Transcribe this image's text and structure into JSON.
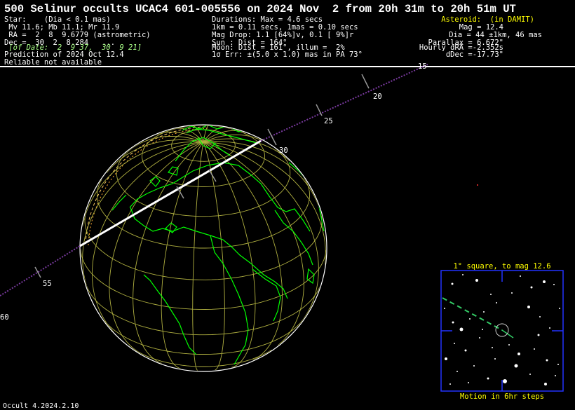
{
  "header": {
    "title": "500 Selinur occults UCAC4 601-005556 on 2024 Nov  2 from 20h 31m to 20h 51m UT"
  },
  "star": {
    "line1": "Star:    (Dia < 0.1 mas)",
    "line2": " Mv 11.6; Mb 11.1; Mr 11.9",
    "line3": " RA =  2  8  9.6779 (astrometric)",
    "line4": "Dec =  30  2  8.284   ...",
    "line5": " [of Date:  2  9 37,  30  9 21]",
    "line6": "Prediction of 2024 Oct 12.4",
    "line7": "Reliable not available"
  },
  "event": {
    "line1": "Durations: Max = 4.6 secs",
    "line2": "1km = 0.11 secs, 1mas = 0.10 secs",
    "line3": "Mag Drop: 1.1 [64%]v, 0.1 [ 9%]r",
    "line4": "Sun : Dist = 164°",
    "line5": "Moon: Dist = 161°, illum =  2%",
    "line6": "1σ Err: ±(5.0 x 1.0) mas in PA 73°"
  },
  "asteroid": {
    "heading": "Asteroid:  (in DAMIT)",
    "line1": "Mag = 12.4",
    "line2": "Dia = 44 ±1km, 46 mas",
    "line3": "Parallax = 6.672\"",
    "line4": "Hourly dRA =-2.352s",
    "line5": "dDec =-17.73\""
  },
  "path_labels": [
    "15",
    "20",
    "25",
    "30",
    "55",
    "60"
  ],
  "starchart": {
    "title": "1° square, to mag 12.6",
    "footer": "Motion in 6hr steps"
  },
  "footer": {
    "version": "Occult 4.2024.2.10"
  },
  "colors": {
    "globe_grid": "#b0b040",
    "coastline": "#00ff00",
    "path": "#ffffff",
    "track": "#7a3aa0",
    "chart_border": "#2233ff",
    "heading_text": "#ffff00"
  }
}
